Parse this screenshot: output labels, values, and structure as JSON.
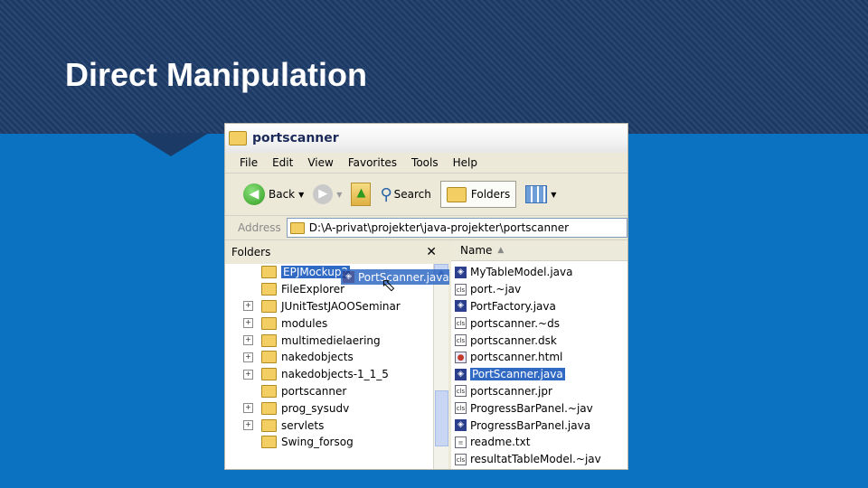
{
  "slide": {
    "title": "Direct Manipulation"
  },
  "window": {
    "title": "portscanner"
  },
  "menu": [
    "File",
    "Edit",
    "View",
    "Favorites",
    "Tools",
    "Help"
  ],
  "toolbar": {
    "back": "Back",
    "search": "Search",
    "folders": "Folders"
  },
  "address": {
    "label": "Address",
    "path": "D:\\A-privat\\projekter\\java-projekter\\portscanner"
  },
  "folders_pane": {
    "title": "Folders",
    "items": [
      {
        "label": "EPJMockup2",
        "expandable": false
      },
      {
        "label": "FileExplorer",
        "expandable": false
      },
      {
        "label": "JUnitTestJAOOSeminar",
        "expandable": true
      },
      {
        "label": "modules",
        "expandable": true
      },
      {
        "label": "multimedielaering",
        "expandable": true
      },
      {
        "label": "nakedobjects",
        "expandable": true
      },
      {
        "label": "nakedobjects-1_1_5",
        "expandable": true
      },
      {
        "label": "portscanner",
        "expandable": false
      },
      {
        "label": "prog_sysudv",
        "expandable": true
      },
      {
        "label": "servlets",
        "expandable": true
      },
      {
        "label": "Swing_forsog",
        "expandable": false
      }
    ],
    "drag_item": "PortScanner.java"
  },
  "files_pane": {
    "column": "Name",
    "files": [
      {
        "label": "MyTableModel.java",
        "icon": "java"
      },
      {
        "label": "port.~jav",
        "icon": "generic"
      },
      {
        "label": "PortFactory.java",
        "icon": "java"
      },
      {
        "label": "portscanner.~ds",
        "icon": "generic"
      },
      {
        "label": "portscanner.dsk",
        "icon": "generic"
      },
      {
        "label": "portscanner.html",
        "icon": "html"
      },
      {
        "label": "PortScanner.java",
        "icon": "java"
      },
      {
        "label": "portscanner.jpr",
        "icon": "generic"
      },
      {
        "label": "ProgressBarPanel.~jav",
        "icon": "generic"
      },
      {
        "label": "ProgressBarPanel.java",
        "icon": "java"
      },
      {
        "label": "readme.txt",
        "icon": "txt"
      },
      {
        "label": "resultatTableModel.~jav",
        "icon": "generic"
      }
    ]
  }
}
